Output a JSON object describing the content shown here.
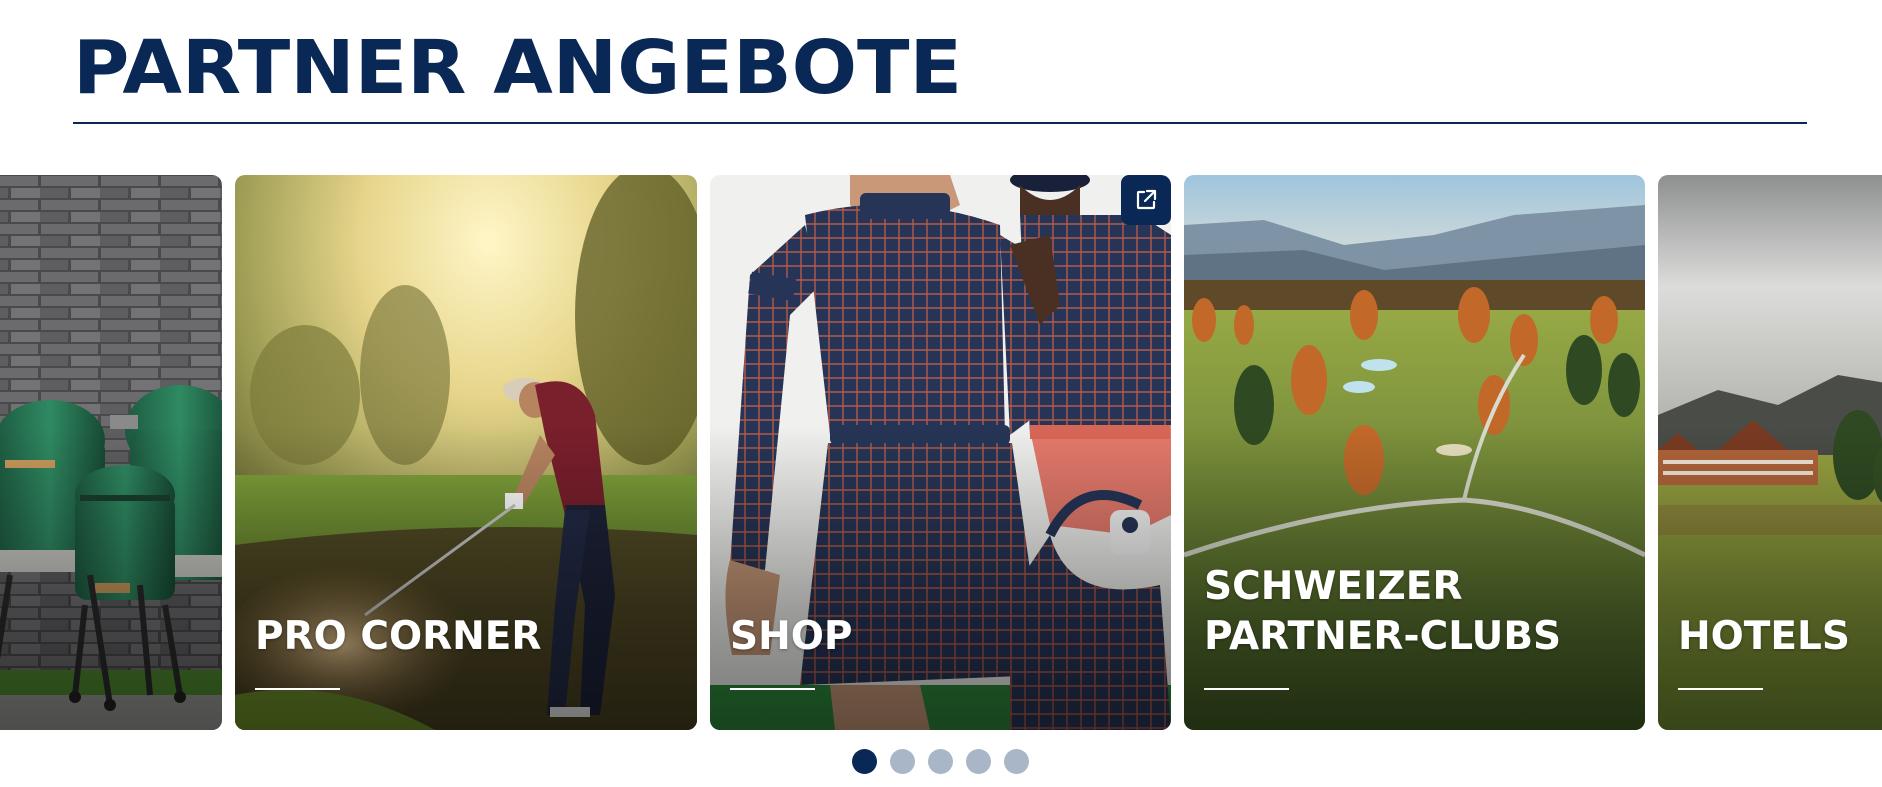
{
  "header": {
    "title": "PARTNER ANGEBOTE"
  },
  "carousel": {
    "cards": [
      {
        "label": "",
        "image": "green-egg-grills-photo"
      },
      {
        "label": "PRO CORNER",
        "image": "golfer-bunker-shot-photo"
      },
      {
        "label": "SHOP",
        "image": "golf-apparel-models-photo",
        "external_link": true
      },
      {
        "label": "SCHWEIZER\nPARTNER-CLUBS",
        "image": "golf-course-aerial-photo"
      },
      {
        "label": "HOTELS",
        "image": "alpine-hotel-photo"
      }
    ],
    "dots": {
      "count": 5,
      "active_index": 0
    }
  },
  "icons": {
    "external_link": "external-link-icon"
  },
  "colors": {
    "brand_navy": "#0a2856",
    "dot_inactive": "#a9b6c8"
  }
}
